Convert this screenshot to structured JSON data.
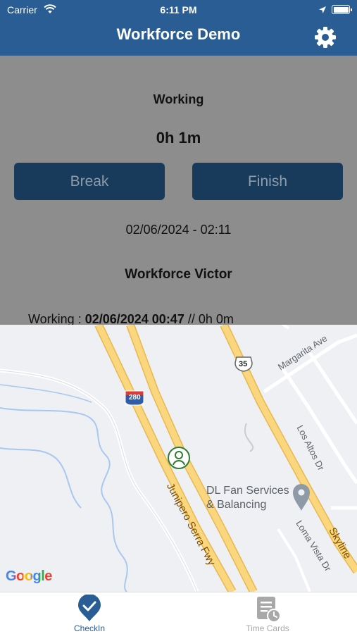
{
  "status_bar": {
    "carrier": "Carrier",
    "time": "6:11 PM"
  },
  "nav": {
    "title": "Workforce Demo",
    "settings_icon": "gear-icon"
  },
  "panel": {
    "state": "Working",
    "duration": "0h 1m",
    "break_label": "Break",
    "finish_label": "Finish",
    "range": "02/06/2024 - 02:11",
    "worker_name": "Workforce Victor",
    "log_prefix": "Working : ",
    "log_time": "02/06/2024 00:47",
    "log_suffix": " // 0h 0m"
  },
  "map": {
    "labels": {
      "margarita": "Margarita Ave",
      "los_altos": "Los Altos Dr",
      "junipero": "Junipero Serra Fwy",
      "loma_vista": "Loma Vista Dr",
      "skyline": "Skyline",
      "shield_280": "280",
      "shield_35": "35"
    },
    "poi_line1": "DL Fan Services",
    "poi_line2": "& Balancing",
    "attribution": "Google"
  },
  "tabs": [
    {
      "label": "CheckIn",
      "icon": "checkin-pin-icon",
      "active": true
    },
    {
      "label": "Time Cards",
      "icon": "time-cards-icon",
      "active": false
    }
  ],
  "colors": {
    "primary": "#2a5d94",
    "button": "#183b5c",
    "panel": "#8d8d8d",
    "road": "#fad77e"
  }
}
